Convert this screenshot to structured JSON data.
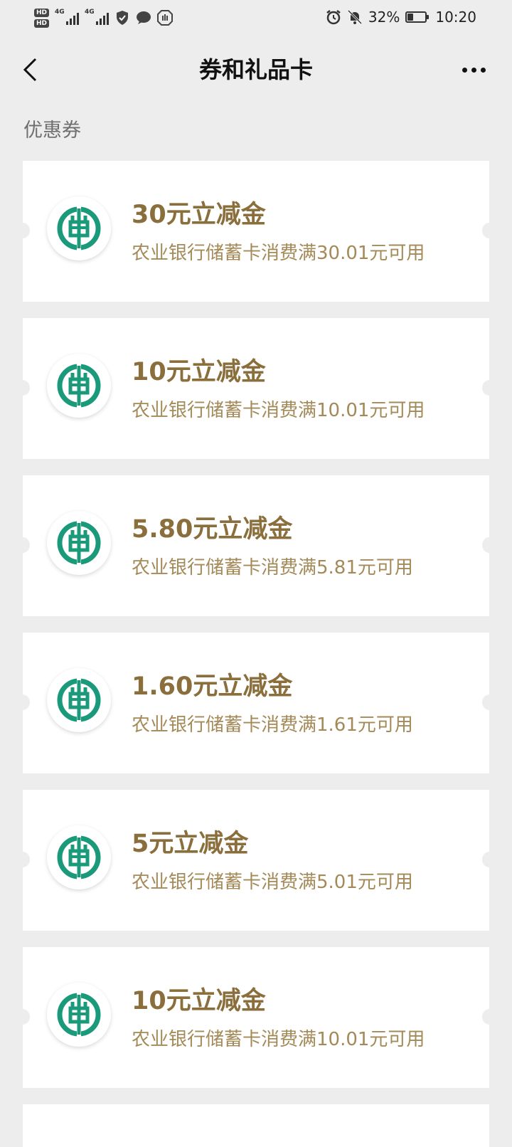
{
  "status_bar": {
    "hd1": "HD",
    "hd2": "HD",
    "net1": "4G",
    "net2": "4G",
    "battery_percent": "32%",
    "battery_level": 0.32,
    "time": "10:20",
    "icons": [
      "shield-check-icon",
      "chat-bubble-icon",
      "hand-stop-icon",
      "alarm-clock-icon",
      "bell-off-icon"
    ]
  },
  "nav": {
    "back_icon": "chevron-left-icon",
    "title": "券和礼品卡",
    "more_icon": "more-dots-icon"
  },
  "section": {
    "title": "优惠券"
  },
  "colors": {
    "background": "#ededed",
    "card": "#ffffff",
    "coupon_title": "#8a6e3b",
    "coupon_desc": "#a38a58",
    "bank_logo": "#1a9a7a"
  },
  "coupons": [
    {
      "title": "30元立减金",
      "desc": "农业银行储蓄卡消费满30.01元可用",
      "logo": "abc-bank-logo-icon"
    },
    {
      "title": "10元立减金",
      "desc": "农业银行储蓄卡消费满10.01元可用",
      "logo": "abc-bank-logo-icon"
    },
    {
      "title": "5.80元立减金",
      "desc": "农业银行储蓄卡消费满5.81元可用",
      "logo": "abc-bank-logo-icon"
    },
    {
      "title": "1.60元立减金",
      "desc": "农业银行储蓄卡消费满1.61元可用",
      "logo": "abc-bank-logo-icon"
    },
    {
      "title": "5元立减金",
      "desc": "农业银行储蓄卡消费满5.01元可用",
      "logo": "abc-bank-logo-icon"
    },
    {
      "title": "10元立减金",
      "desc": "农业银行储蓄卡消费满10.01元可用",
      "logo": "abc-bank-logo-icon"
    }
  ]
}
